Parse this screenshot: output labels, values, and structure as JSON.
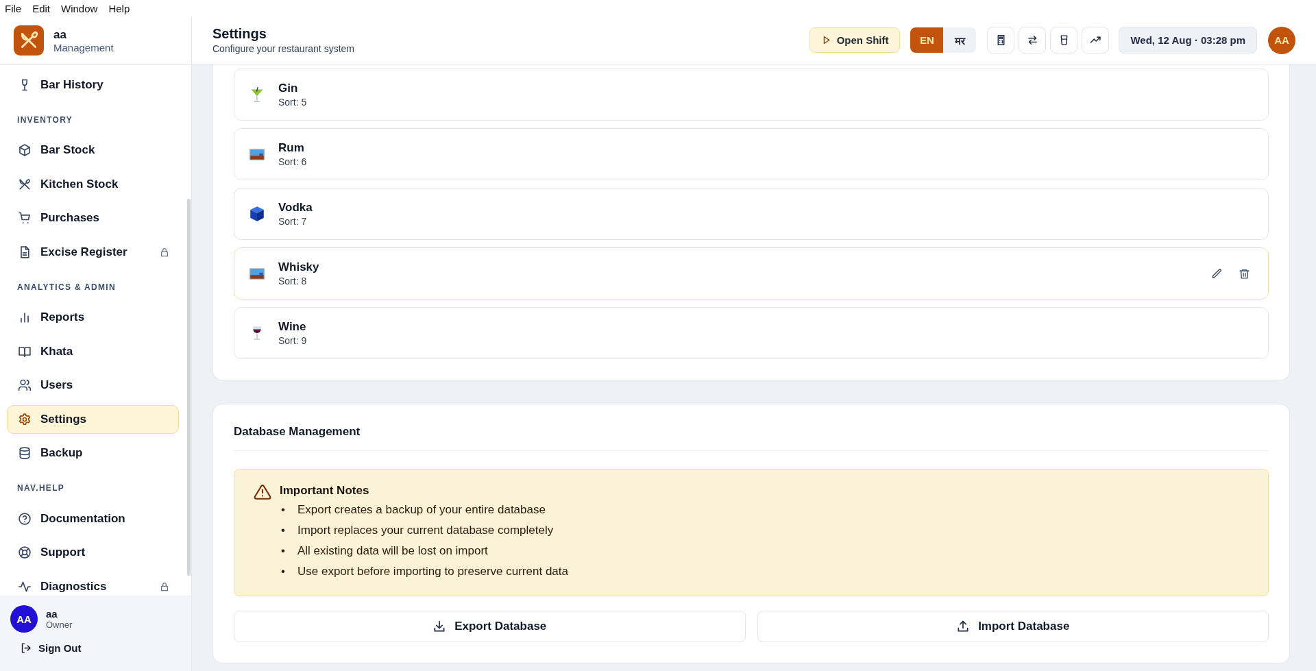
{
  "menu_bar": [
    "File",
    "Edit",
    "Window",
    "Help"
  ],
  "brand": {
    "name": "aa",
    "subtitle": "Management"
  },
  "nav": [
    {
      "items": [
        {
          "label": "Bar History",
          "kind": "glass",
          "locked": false,
          "selected": false
        }
      ]
    },
    {
      "heading": "INVENTORY",
      "items": [
        {
          "label": "Bar Stock",
          "kind": "box",
          "locked": false,
          "selected": false
        },
        {
          "label": "Kitchen Stock",
          "kind": "utensils",
          "locked": false,
          "selected": false
        },
        {
          "label": "Purchases",
          "kind": "cart",
          "locked": false,
          "selected": false
        },
        {
          "label": "Excise Register",
          "kind": "file",
          "locked": true,
          "selected": false
        }
      ]
    },
    {
      "heading": "ANALYTICS & ADMIN",
      "items": [
        {
          "label": "Reports",
          "kind": "chart",
          "locked": false,
          "selected": false
        },
        {
          "label": "Khata",
          "kind": "book",
          "locked": false,
          "selected": false
        },
        {
          "label": "Users",
          "kind": "users",
          "locked": false,
          "selected": false
        },
        {
          "label": "Settings",
          "kind": "gear",
          "locked": false,
          "selected": true
        },
        {
          "label": "Backup",
          "kind": "database",
          "locked": false,
          "selected": false
        }
      ]
    },
    {
      "heading": "NAV.HELP",
      "items": [
        {
          "label": "Documentation",
          "kind": "help",
          "locked": false,
          "selected": false
        },
        {
          "label": "Support",
          "kind": "lifebuoy",
          "locked": false,
          "selected": false
        },
        {
          "label": "Diagnostics",
          "kind": "pulse",
          "locked": true,
          "selected": false
        }
      ]
    }
  ],
  "user": {
    "initials": "AA",
    "name": "aa",
    "role": "Owner"
  },
  "sign_out": "Sign Out",
  "header": {
    "title": "Settings",
    "subtitle": "Configure your restaurant system",
    "shift_button": "Open Shift",
    "languages": [
      {
        "label": "EN",
        "selected": true
      },
      {
        "label": "मर",
        "selected": false
      }
    ],
    "tools": [
      {
        "kind": "calculator"
      },
      {
        "kind": "swap"
      },
      {
        "kind": "cup"
      },
      {
        "kind": "trend"
      }
    ],
    "datetime": "Wed, 12 Aug · 03:28 pm",
    "avatar": "AA"
  },
  "categories": [
    {
      "name": "Gin",
      "sort": "Sort: 5",
      "kind": "cocktail",
      "hovered": false
    },
    {
      "name": "Rum",
      "sort": "Sort: 6",
      "kind": "image",
      "hovered": false
    },
    {
      "name": "Vodka",
      "sort": "Sort: 7",
      "kind": "cube",
      "hovered": false
    },
    {
      "name": "Whisky",
      "sort": "Sort: 8",
      "kind": "image",
      "hovered": true
    },
    {
      "name": "Wine",
      "sort": "Sort: 9",
      "kind": "wine",
      "hovered": false
    }
  ],
  "database": {
    "title": "Database Management",
    "notes_title": "Important Notes",
    "bullet": "•",
    "notes": [
      "Export creates a backup of your entire database",
      "Import replaces your current database completely",
      "All existing data will be lost on import",
      "Use export before importing to preserve current data"
    ],
    "buttons": [
      {
        "label": "Export Database",
        "kind": "export"
      },
      {
        "label": "Import Database",
        "kind": "import"
      }
    ]
  }
}
